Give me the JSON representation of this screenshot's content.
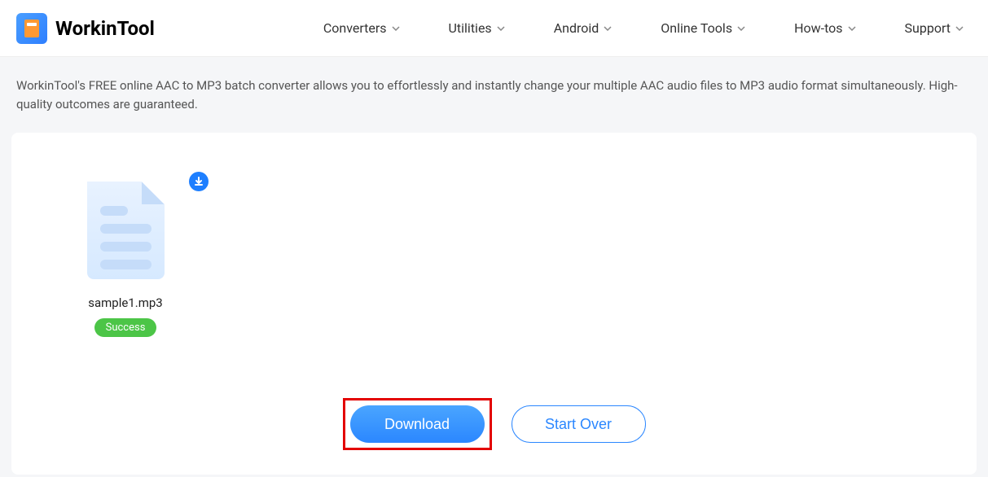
{
  "brand": "WorkinTool",
  "nav": {
    "items": [
      {
        "label": "Converters"
      },
      {
        "label": "Utilities"
      },
      {
        "label": "Android"
      },
      {
        "label": "Online Tools"
      },
      {
        "label": "How-tos"
      },
      {
        "label": "Support"
      }
    ]
  },
  "description": "WorkinTool's FREE online AAC to MP3 batch converter allows you to effortlessly and instantly change your multiple AAC audio files to MP3 audio format simultaneously. High-quality outcomes are guaranteed.",
  "file": {
    "name": "sample1.mp3",
    "status": "Success"
  },
  "buttons": {
    "download": "Download",
    "startOver": "Start Over"
  }
}
